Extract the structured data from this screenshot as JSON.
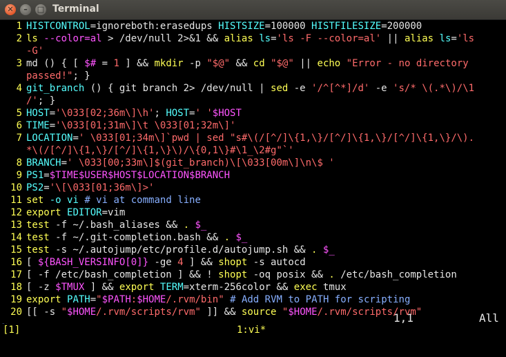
{
  "window": {
    "title": "Terminal",
    "close_glyph": "✕",
    "min_glyph": "–",
    "max_glyph": "□"
  },
  "lines": [
    {
      "n": "1",
      "segs": [
        [
          "i",
          "HISTCONTROL"
        ],
        [
          "t",
          "=ignoreboth:erasedups "
        ],
        [
          "i",
          "HISTSIZE"
        ],
        [
          "t",
          "=100000 "
        ],
        [
          "i",
          "HISTFILESIZE"
        ],
        [
          "t",
          "=200000"
        ]
      ]
    },
    {
      "n": "2",
      "segs": [
        [
          "k",
          "ls"
        ],
        [
          "t",
          " "
        ],
        [
          "p",
          "--color=al"
        ],
        [
          "t",
          " > /dev/null 2>&1 && "
        ],
        [
          "k",
          "alias"
        ],
        [
          "t",
          " "
        ],
        [
          "i",
          "ls"
        ],
        [
          "t",
          "="
        ],
        [
          "s",
          "'ls -F --color=al'"
        ],
        [
          "t",
          " || "
        ],
        [
          "k",
          "alias"
        ],
        [
          "t",
          " "
        ],
        [
          "i",
          "ls"
        ],
        [
          "t",
          "="
        ],
        [
          "s",
          "'ls"
        ]
      ]
    },
    {
      "n": "",
      "segs": [
        [
          "s",
          "-G'"
        ]
      ]
    },
    {
      "n": "3",
      "segs": [
        [
          "t",
          "md () { [ "
        ],
        [
          "p",
          "$#"
        ],
        [
          "t",
          " = "
        ],
        [
          "s",
          "1"
        ],
        [
          "t",
          " ] && "
        ],
        [
          "k",
          "mkdir"
        ],
        [
          "t",
          " -p "
        ],
        [
          "s",
          "\"$@\""
        ],
        [
          "t",
          " && "
        ],
        [
          "k",
          "cd"
        ],
        [
          "t",
          " "
        ],
        [
          "s",
          "\"$@\""
        ],
        [
          "t",
          " || "
        ],
        [
          "k",
          "echo"
        ],
        [
          "t",
          " "
        ],
        [
          "s",
          "\"Error - no directory"
        ]
      ]
    },
    {
      "n": "",
      "segs": [
        [
          "s",
          "passed!\""
        ],
        [
          "t",
          "; }"
        ]
      ]
    },
    {
      "n": "4",
      "segs": [
        [
          "i",
          "git_branch"
        ],
        [
          "t",
          " () { git branch 2> /dev/null | "
        ],
        [
          "k",
          "sed"
        ],
        [
          "t",
          " -e "
        ],
        [
          "s",
          "'/^[^*]/d'"
        ],
        [
          "t",
          " -e "
        ],
        [
          "s",
          "'s/* \\(.*\\)/\\1"
        ]
      ]
    },
    {
      "n": "",
      "segs": [
        [
          "s",
          "/'"
        ],
        [
          "t",
          "; }"
        ]
      ]
    },
    {
      "n": "5",
      "segs": [
        [
          "i",
          "HOST"
        ],
        [
          "t",
          "="
        ],
        [
          "s",
          "'\\033[02;36m\\]\\h'"
        ],
        [
          "t",
          "; "
        ],
        [
          "i",
          "HOST"
        ],
        [
          "t",
          "="
        ],
        [
          "s",
          "' '"
        ],
        [
          "p",
          "$HOST"
        ]
      ]
    },
    {
      "n": "6",
      "segs": [
        [
          "i",
          "TIME"
        ],
        [
          "t",
          "="
        ],
        [
          "s",
          "'\\033[01;31m\\]\\t \\033[01;32m\\]'"
        ]
      ]
    },
    {
      "n": "7",
      "segs": [
        [
          "i",
          "LOCATION"
        ],
        [
          "t",
          "="
        ],
        [
          "s",
          "' \\033[01;34m\\]`pwd | sed \"s#\\(/[^/]\\{1,\\}/[^/]\\{1,\\}/[^/]\\{1,\\}/\\)."
        ]
      ]
    },
    {
      "n": "",
      "segs": [
        [
          "s",
          "*\\(/[^/]\\{1,\\}/[^/]\\{1,\\}\\)/\\{0,1\\}#\\1_\\2#g\"`'"
        ]
      ]
    },
    {
      "n": "8",
      "segs": [
        [
          "i",
          "BRANCH"
        ],
        [
          "t",
          "="
        ],
        [
          "s",
          "' \\033[00;33m\\]$(git_branch)\\[\\033[00m\\]\\n\\$ '"
        ]
      ]
    },
    {
      "n": "9",
      "segs": [
        [
          "i",
          "PS1"
        ],
        [
          "t",
          "="
        ],
        [
          "p",
          "$TIME$USER$HOST$LOCATION$BRANCH"
        ]
      ]
    },
    {
      "n": "10",
      "segs": [
        [
          "i",
          "PS2"
        ],
        [
          "t",
          "="
        ],
        [
          "s",
          "'\\[\\033[01;36m\\]>'"
        ]
      ]
    },
    {
      "n": "11",
      "segs": [
        [
          "k",
          "set"
        ],
        [
          "t",
          " "
        ],
        [
          "i",
          "-o vi"
        ],
        [
          "t",
          " "
        ],
        [
          "c",
          "# vi at command line"
        ]
      ]
    },
    {
      "n": "12",
      "segs": [
        [
          "k",
          "export"
        ],
        [
          "t",
          " "
        ],
        [
          "i",
          "EDITOR"
        ],
        [
          "t",
          "=vim"
        ]
      ]
    },
    {
      "n": "13",
      "segs": [
        [
          "k",
          "test"
        ],
        [
          "t",
          " -f ~/.bash_aliases && "
        ],
        [
          "k",
          "."
        ],
        [
          "t",
          " "
        ],
        [
          "p",
          "$_"
        ]
      ]
    },
    {
      "n": "14",
      "segs": [
        [
          "k",
          "test"
        ],
        [
          "t",
          " -f ~/.git-completion.bash && "
        ],
        [
          "k",
          "."
        ],
        [
          "t",
          " "
        ],
        [
          "p",
          "$_"
        ]
      ]
    },
    {
      "n": "15",
      "segs": [
        [
          "k",
          "test"
        ],
        [
          "t",
          " -s ~/.autojump/etc/profile.d/autojump.sh && "
        ],
        [
          "k",
          "."
        ],
        [
          "t",
          " "
        ],
        [
          "p",
          "$_"
        ]
      ]
    },
    {
      "n": "16",
      "segs": [
        [
          "t",
          "[ "
        ],
        [
          "p",
          "${BASH_VERSINFO[0]}"
        ],
        [
          "t",
          " -ge "
        ],
        [
          "s",
          "4"
        ],
        [
          "t",
          " ] && "
        ],
        [
          "k",
          "shopt"
        ],
        [
          "t",
          " -s autocd"
        ]
      ]
    },
    {
      "n": "17",
      "segs": [
        [
          "t",
          "[ -f /etc/bash_completion ] && ! "
        ],
        [
          "k",
          "shopt"
        ],
        [
          "t",
          " -oq posix && "
        ],
        [
          "k",
          "."
        ],
        [
          "t",
          " /etc/bash_completion"
        ]
      ]
    },
    {
      "n": "18",
      "segs": [
        [
          "t",
          "[ -z "
        ],
        [
          "p",
          "$TMUX"
        ],
        [
          "t",
          " ] && "
        ],
        [
          "k",
          "export"
        ],
        [
          "t",
          " "
        ],
        [
          "i",
          "TERM"
        ],
        [
          "t",
          "=xterm-256color && "
        ],
        [
          "k",
          "exec"
        ],
        [
          "t",
          " tmux"
        ]
      ]
    },
    {
      "n": "19",
      "segs": [
        [
          "k",
          "export"
        ],
        [
          "t",
          " "
        ],
        [
          "i",
          "PATH"
        ],
        [
          "t",
          "="
        ],
        [
          "s",
          "\""
        ],
        [
          "p",
          "$PATH"
        ],
        [
          "s",
          ":"
        ],
        [
          "p",
          "$HOME"
        ],
        [
          "s",
          "/.rvm/bin\""
        ],
        [
          "t",
          " "
        ],
        [
          "c",
          "# Add RVM to PATH for scripting"
        ]
      ]
    },
    {
      "n": "20",
      "segs": [
        [
          "t",
          "[[ -s "
        ],
        [
          "s",
          "\""
        ],
        [
          "p",
          "$HOME"
        ],
        [
          "s",
          "/.rvm/scripts/rvm\""
        ],
        [
          "t",
          " ]] && "
        ],
        [
          "k",
          "source"
        ],
        [
          "t",
          " "
        ],
        [
          "s",
          "\""
        ],
        [
          "p",
          "$HOME"
        ],
        [
          "s",
          "/.rvm/scripts/rvm\""
        ]
      ]
    }
  ],
  "tilde": "~",
  "status": {
    "position": "1,1",
    "scroll": "All"
  },
  "tmux": {
    "session": "[1]",
    "window": "1:vi*"
  }
}
